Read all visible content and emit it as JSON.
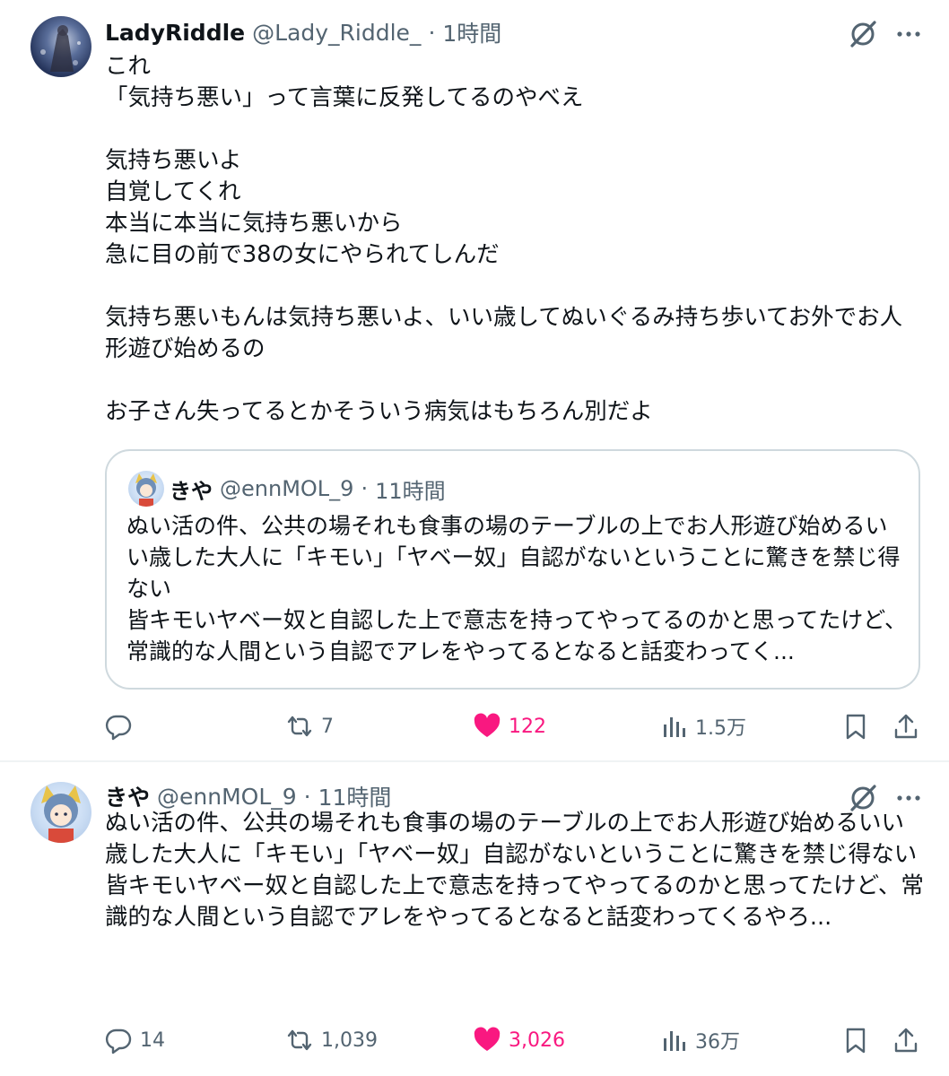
{
  "tweets": [
    {
      "name": "LadyRiddle",
      "handle": "@Lady_Riddle_",
      "dot": "·",
      "time": "1時間",
      "text": "これ\n「気持ち悪い」って言葉に反発してるのやべえ\n\n気持ち悪いよ\n自覚してくれ\n本当に本当に気持ち悪いから\n急に目の前で38の女にやられてしんだ\n\n気持ち悪いもんは気持ち悪いよ、いい歳してぬいぐるみ持ち歩いてお外でお人形遊び始めるの\n\nお子さん失ってるとかそういう病気はもちろん別だよ",
      "quote": {
        "name": "きや",
        "handle": "@ennMOL_9",
        "dot": "·",
        "time": "11時間",
        "text": "ぬい活の件、公共の場それも食事の場のテーブルの上でお人形遊び始めるいい歳した大人に「キモい」「ヤベー奴」自認がないということに驚きを禁じ得ない\n皆キモいヤベー奴と自認した上で意志を持ってやってるのかと思ってたけど、常識的な人間という自認でアレをやってるとなると話変わってく..."
      },
      "stats": {
        "replies": "",
        "retweets": "7",
        "likes": "122",
        "views": "1.5万"
      }
    },
    {
      "name": "きや",
      "handle": "@ennMOL_9",
      "dot": "·",
      "time": "11時間",
      "text": "ぬい活の件、公共の場それも食事の場のテーブルの上でお人形遊び始めるいい歳した大人に「キモい」「ヤベー奴」自認がないということに驚きを禁じ得ない\n皆キモいヤベー奴と自認した上で意志を持ってやってるのかと思ってたけど、常識的な人間という自認でアレをやってるとなると話変わってくるやろ...",
      "stats": {
        "replies": "14",
        "retweets": "1,039",
        "likes": "3,026",
        "views": "36万"
      }
    }
  ],
  "colors": {
    "text": "#0f1419",
    "secondary": "#536471",
    "like": "#f91880",
    "border": "#cfd9de"
  },
  "icons": [
    "grok-icon",
    "more-icon",
    "reply-icon",
    "retweet-icon",
    "like-icon",
    "views-icon",
    "bookmark-icon",
    "share-icon"
  ]
}
